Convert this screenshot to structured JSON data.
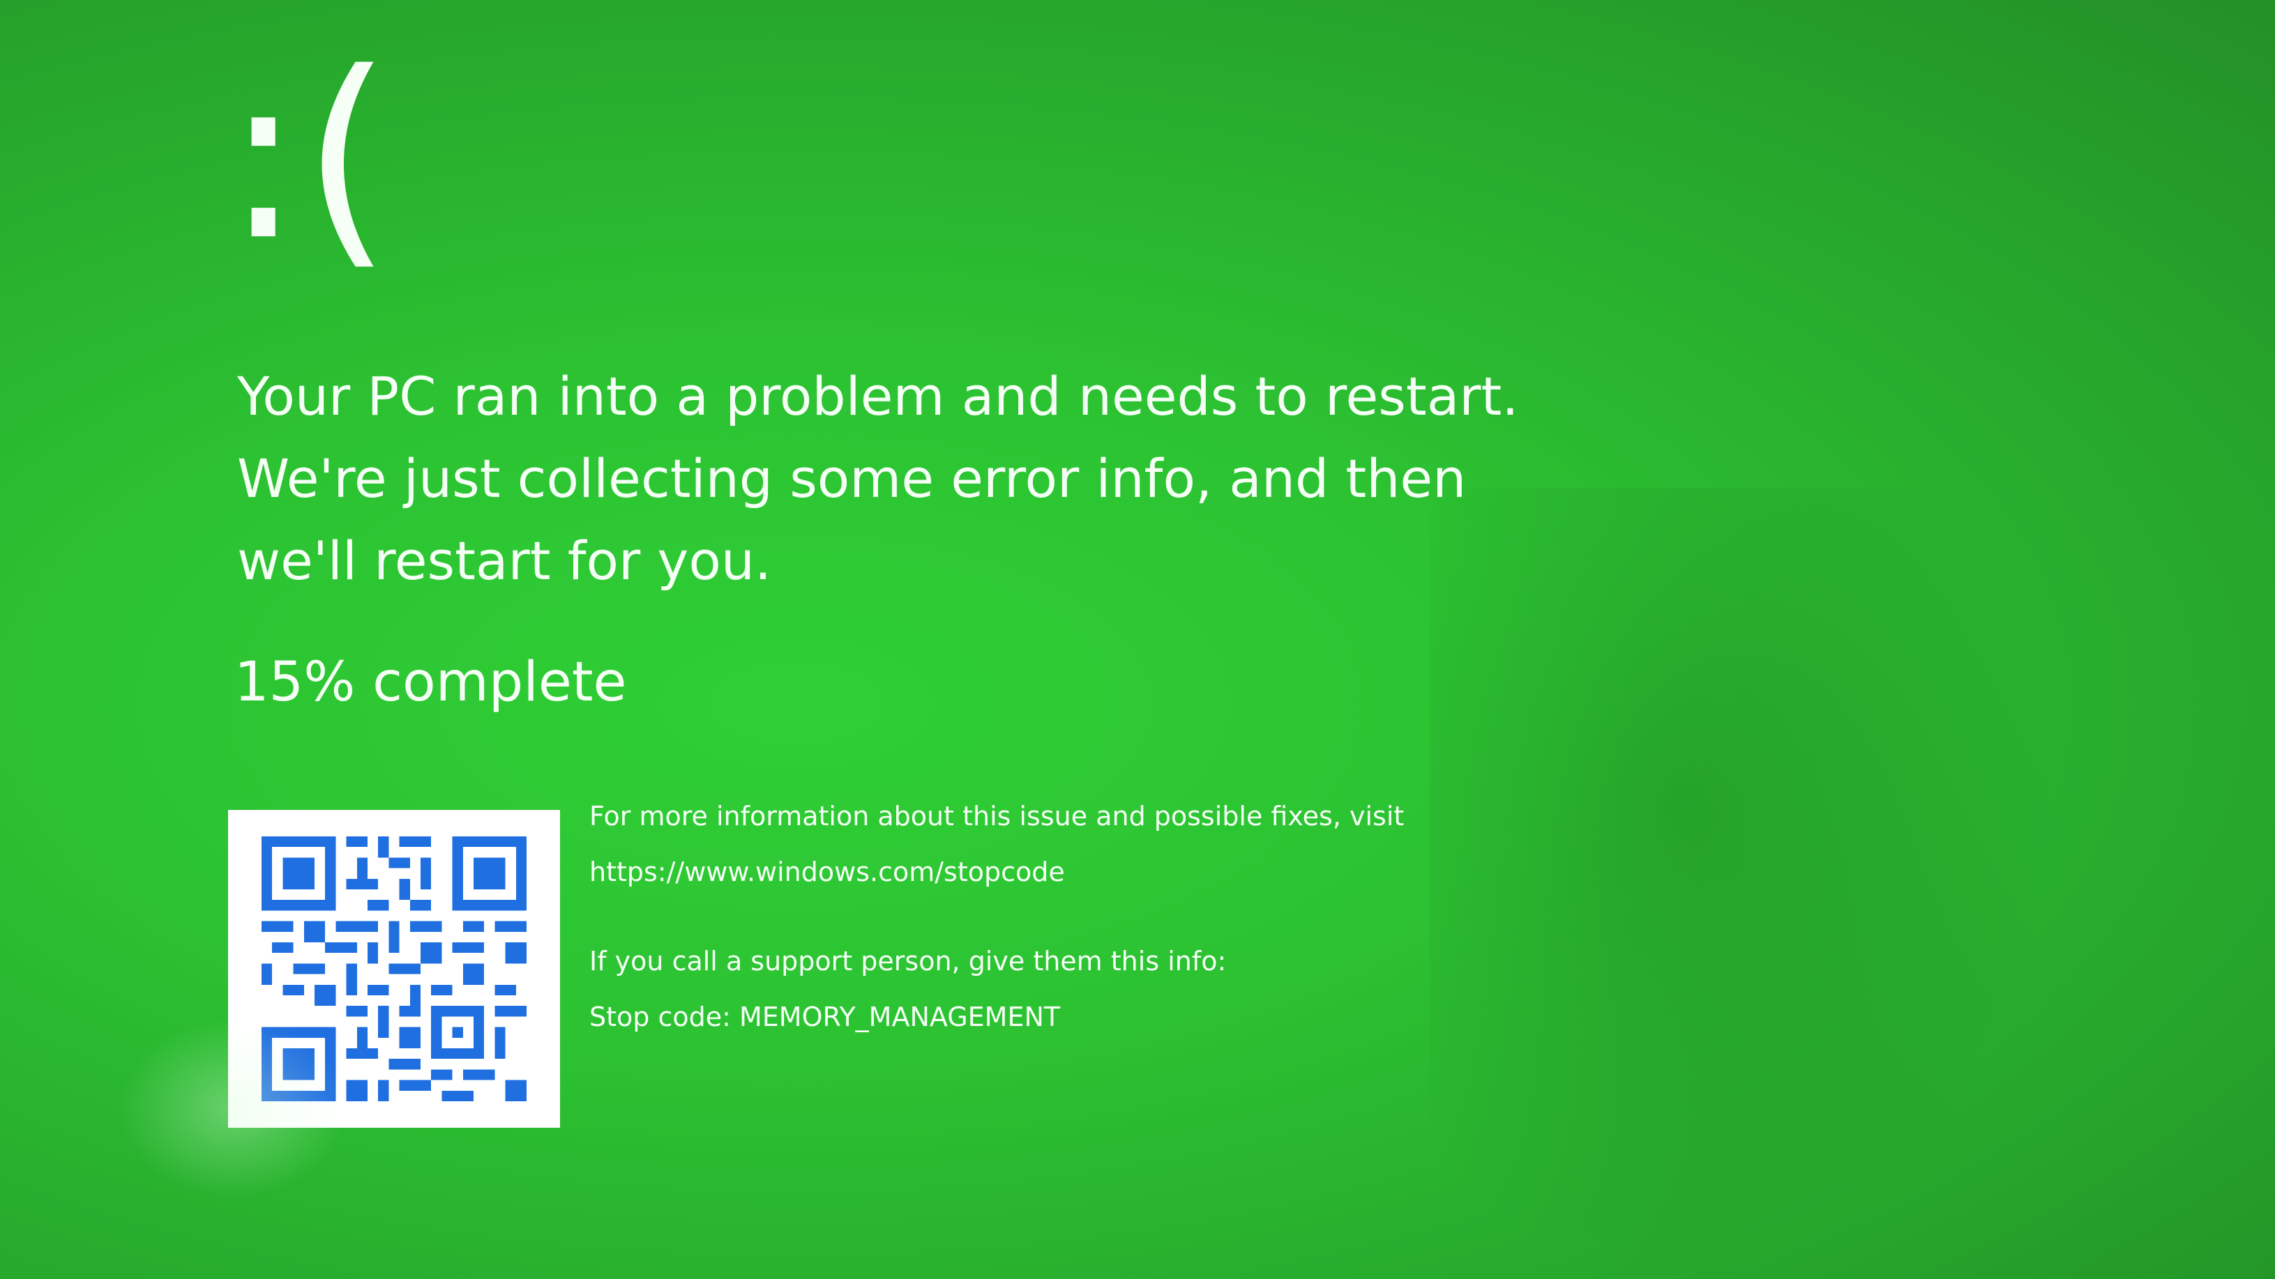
{
  "screen": {
    "background_color": "#2ec234",
    "frown": ":(",
    "message": "Your PC ran into a problem and needs to restart. We're just collecting some error info, and then we'll restart for you.",
    "progress_text": "15% complete",
    "progress_value_percent": 15,
    "info_text": "For more information about this issue and possible fixes, visit",
    "info_url": "https://www.windows.com/stopcode",
    "support_text": "If you call a support person, give them this info:",
    "stop_code_text": "Stop code: MEMORY_MANAGEMENT",
    "qr_icon": "qr-code-icon",
    "qr_color": "#1f6fe0"
  }
}
